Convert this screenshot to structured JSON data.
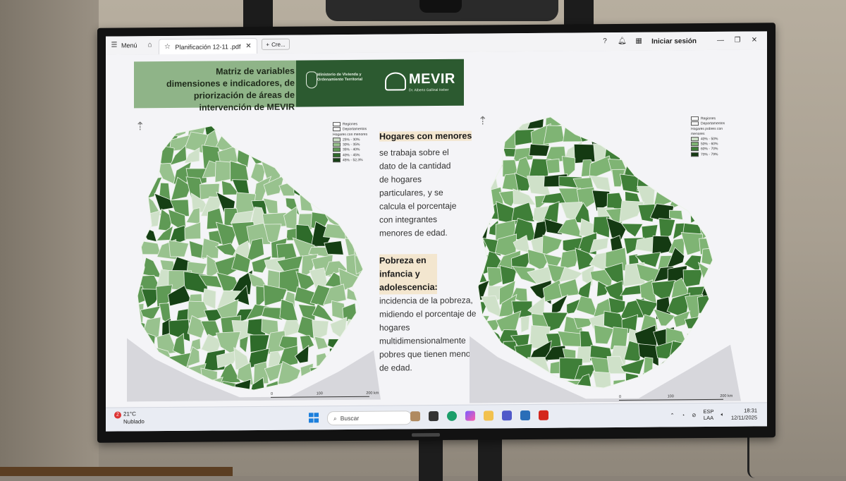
{
  "toolbar": {
    "menu_label": "Menú",
    "tab_title": "Planificación 12-11 .pdf",
    "new_tab_label": "Cre...",
    "signin_label": "Iniciar sesión"
  },
  "slide": {
    "header_title": "Matriz de variables dimensiones e indicadores, de priorización de áreas de intervención de MEVIR",
    "ministry": "Ministerio de Vivienda y Ordenamiento Territorial",
    "mevir": "MEVIR",
    "mevir_sub": "Dr. Alberto Gallinal Heber",
    "section1_title": "Hogares con menores",
    "section1_body": "se trabaja sobre el dato de la cantidad de hogares particulares, y se calcula el porcentaje con integrantes menores de edad.",
    "section2_title": "Pobreza en infancia y adolescencia:",
    "section2_body": "incidencia de la pobreza, midiendo el porcentaje de hogares multidimensionalmente pobres que tienen menores de edad."
  },
  "map_left": {
    "legend_regions": "Regiones",
    "legend_departments": "Departamentos",
    "legend_title": "Hogares con menores",
    "classes": [
      "25% - 30%",
      "30% - 35%",
      "35% - 40%",
      "40% - 45%",
      "45% - 52,3%"
    ],
    "colors": [
      "#cfe1c9",
      "#98c28e",
      "#5f9a55",
      "#2e6b2a",
      "#153f14"
    ],
    "scale": [
      "0",
      "100",
      "200 km"
    ]
  },
  "map_right": {
    "legend_regions": "Regiones",
    "legend_departments": "Departamentos",
    "legend_title": "Hogares pobres con menores",
    "classes": [
      "40% - 50%",
      "50% - 60%",
      "60% - 70%",
      "70% - 79%"
    ],
    "colors": [
      "#cfe1c9",
      "#7fb474",
      "#3f7f38",
      "#143a12"
    ],
    "scale": [
      "0",
      "100",
      "200 km"
    ]
  },
  "taskbar": {
    "weather_temp": "21°C",
    "weather_desc": "Nublado",
    "weather_badge": "2",
    "search_label": "Buscar",
    "lang_top": "ESP",
    "lang_bottom": "LAA",
    "time": "18:31",
    "date": "12/11/2025"
  }
}
